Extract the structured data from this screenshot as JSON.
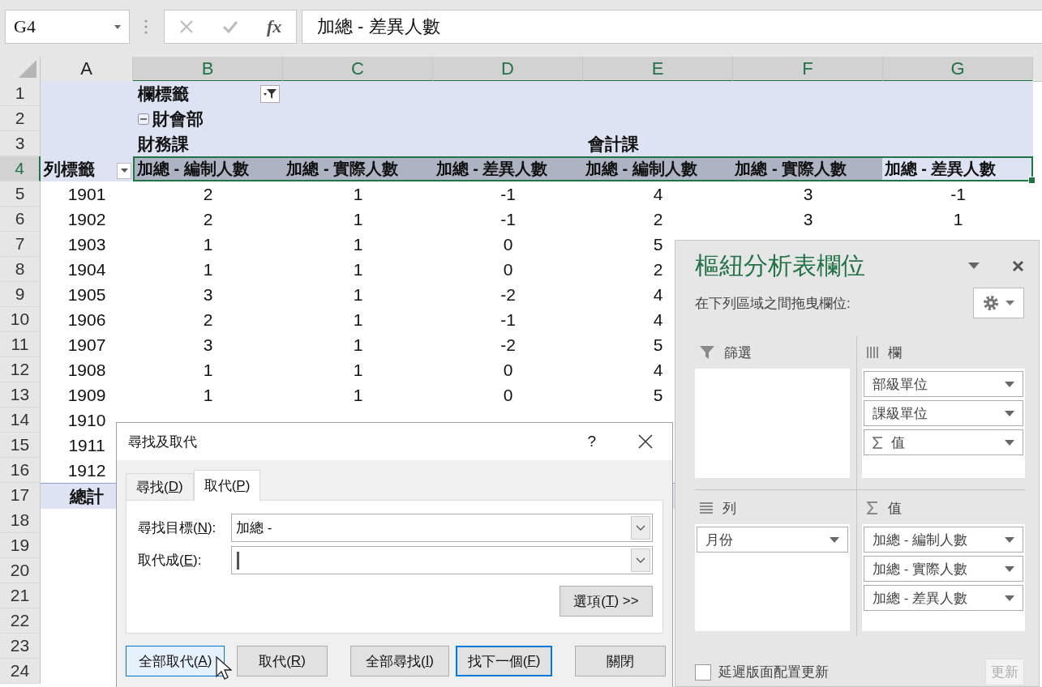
{
  "formula_bar": {
    "name_box": "G4",
    "function_label": "fx",
    "formula": "加總 - 差異人數"
  },
  "sheet": {
    "columns": [
      {
        "label": "A",
        "selected": false
      },
      {
        "label": "B",
        "selected": true
      },
      {
        "label": "C",
        "selected": true
      },
      {
        "label": "D",
        "selected": true
      },
      {
        "label": "E",
        "selected": true
      },
      {
        "label": "F",
        "selected": true
      },
      {
        "label": "G",
        "selected": true
      }
    ],
    "rows": [
      {
        "number": "1",
        "selected": false,
        "kind": "column-label",
        "text": "欄標籤"
      },
      {
        "number": "2",
        "selected": false,
        "kind": "group",
        "text": "財會部",
        "expanded": true
      },
      {
        "number": "3",
        "selected": false,
        "kind": "subgroups",
        "items": [
          "財務課",
          "會計課"
        ]
      },
      {
        "number": "4",
        "selected": true,
        "kind": "value-headers",
        "row_label": "列標籤",
        "headers": [
          {
            "text": "加總 - 編制人數",
            "selected": false
          },
          {
            "text": "加總 - 實際人數",
            "selected": false
          },
          {
            "text": "加總 - 差異人數",
            "selected": false
          },
          {
            "text": "加總 - 編制人數",
            "selected": false
          },
          {
            "text": "加總 - 實際人數",
            "selected": false
          },
          {
            "text": "加總 - 差異人數",
            "selected": true
          }
        ]
      },
      {
        "number": "5",
        "selected": false,
        "kind": "data",
        "label": "1901",
        "values": [
          "2",
          "1",
          "-1",
          "4",
          "3",
          "-1"
        ]
      },
      {
        "number": "6",
        "selected": false,
        "kind": "data",
        "label": "1902",
        "values": [
          "2",
          "1",
          "-1",
          "2",
          "3",
          "1"
        ]
      },
      {
        "number": "7",
        "selected": false,
        "kind": "data",
        "label": "1903",
        "values": [
          "1",
          "1",
          "0",
          "5"
        ]
      },
      {
        "number": "8",
        "selected": false,
        "kind": "data",
        "label": "1904",
        "values": [
          "1",
          "1",
          "0",
          "2"
        ]
      },
      {
        "number": "9",
        "selected": false,
        "kind": "data",
        "label": "1905",
        "values": [
          "3",
          "1",
          "-2",
          "4"
        ]
      },
      {
        "number": "10",
        "selected": false,
        "kind": "data",
        "label": "1906",
        "values": [
          "2",
          "1",
          "-1",
          "4"
        ]
      },
      {
        "number": "11",
        "selected": false,
        "kind": "data",
        "label": "1907",
        "values": [
          "3",
          "1",
          "-2",
          "5"
        ]
      },
      {
        "number": "12",
        "selected": false,
        "kind": "data",
        "label": "1908",
        "values": [
          "1",
          "1",
          "0",
          "4"
        ]
      },
      {
        "number": "13",
        "selected": false,
        "kind": "data",
        "label": "1909",
        "values": [
          "1",
          "1",
          "0",
          "5"
        ]
      },
      {
        "number": "14",
        "selected": false,
        "kind": "data",
        "label": "1910"
      },
      {
        "number": "15",
        "selected": false,
        "kind": "data",
        "label": "1911"
      },
      {
        "number": "16",
        "selected": false,
        "kind": "data",
        "label": "1912"
      },
      {
        "number": "17",
        "selected": false,
        "kind": "total",
        "label": "總計"
      },
      {
        "number": "18",
        "selected": false,
        "kind": "empty"
      },
      {
        "number": "19",
        "selected": false,
        "kind": "empty"
      },
      {
        "number": "20",
        "selected": false,
        "kind": "empty"
      },
      {
        "number": "21",
        "selected": false,
        "kind": "empty"
      },
      {
        "number": "22",
        "selected": false,
        "kind": "empty"
      },
      {
        "number": "23",
        "selected": false,
        "kind": "empty"
      },
      {
        "number": "24",
        "selected": false,
        "kind": "empty"
      }
    ]
  },
  "pivot_panel": {
    "title": "樞紐分析表欄位",
    "subtitle": "在下列區域之間拖曳欄位:",
    "areas": [
      {
        "kind": "filters",
        "label": "篩選"
      },
      {
        "kind": "columns",
        "label": "欄",
        "fields": [
          {
            "kind": "field",
            "text": "部級單位"
          },
          {
            "kind": "field",
            "text": "課級單位"
          },
          {
            "kind": "values",
            "text": "值"
          }
        ]
      },
      {
        "kind": "rows",
        "label": "列",
        "fields": [
          {
            "kind": "field",
            "text": "月份"
          }
        ]
      },
      {
        "kind": "values",
        "label": "值",
        "fields": [
          {
            "kind": "field",
            "text": "加總 - 編制人數"
          },
          {
            "kind": "field",
            "text": "加總 - 實際人數"
          },
          {
            "kind": "field",
            "text": "加總 - 差異人數"
          }
        ]
      }
    ],
    "defer_update": {
      "label": "延遲版面配置更新",
      "checked": false
    },
    "update_button": {
      "label": "更新",
      "disabled": true
    }
  },
  "dialog": {
    "title": "尋找及取代",
    "help": "?",
    "tabs": [
      {
        "pre": "尋找(",
        "key": "D",
        "post": ")",
        "selected": false
      },
      {
        "pre": "取代(",
        "key": "P",
        "post": ")",
        "selected": true
      }
    ],
    "fields": [
      {
        "label": {
          "pre": "尋找目標(",
          "key": "N",
          "post": "):"
        },
        "value": "加總 -",
        "focused": false
      },
      {
        "label": {
          "pre": "取代成(",
          "key": "E",
          "post": "):"
        },
        "focused": true
      }
    ],
    "options_button": {
      "pre": "選項(",
      "key": "T",
      "post": ") >>"
    },
    "buttons": [
      {
        "pre": "全部取代(",
        "key": "A",
        "post": ")",
        "hovered": true,
        "default": false
      },
      {
        "pre": "取代(",
        "key": "R",
        "post": ")",
        "hovered": false,
        "default": false
      },
      {
        "pre": "全部尋找(",
        "key": "I",
        "post": ")",
        "hovered": false,
        "default": false
      },
      {
        "pre": "找下一個(",
        "key": "F",
        "post": ")",
        "hovered": false,
        "default": true
      },
      {
        "pre": "關閉",
        "hovered": false,
        "default": false
      }
    ]
  }
}
